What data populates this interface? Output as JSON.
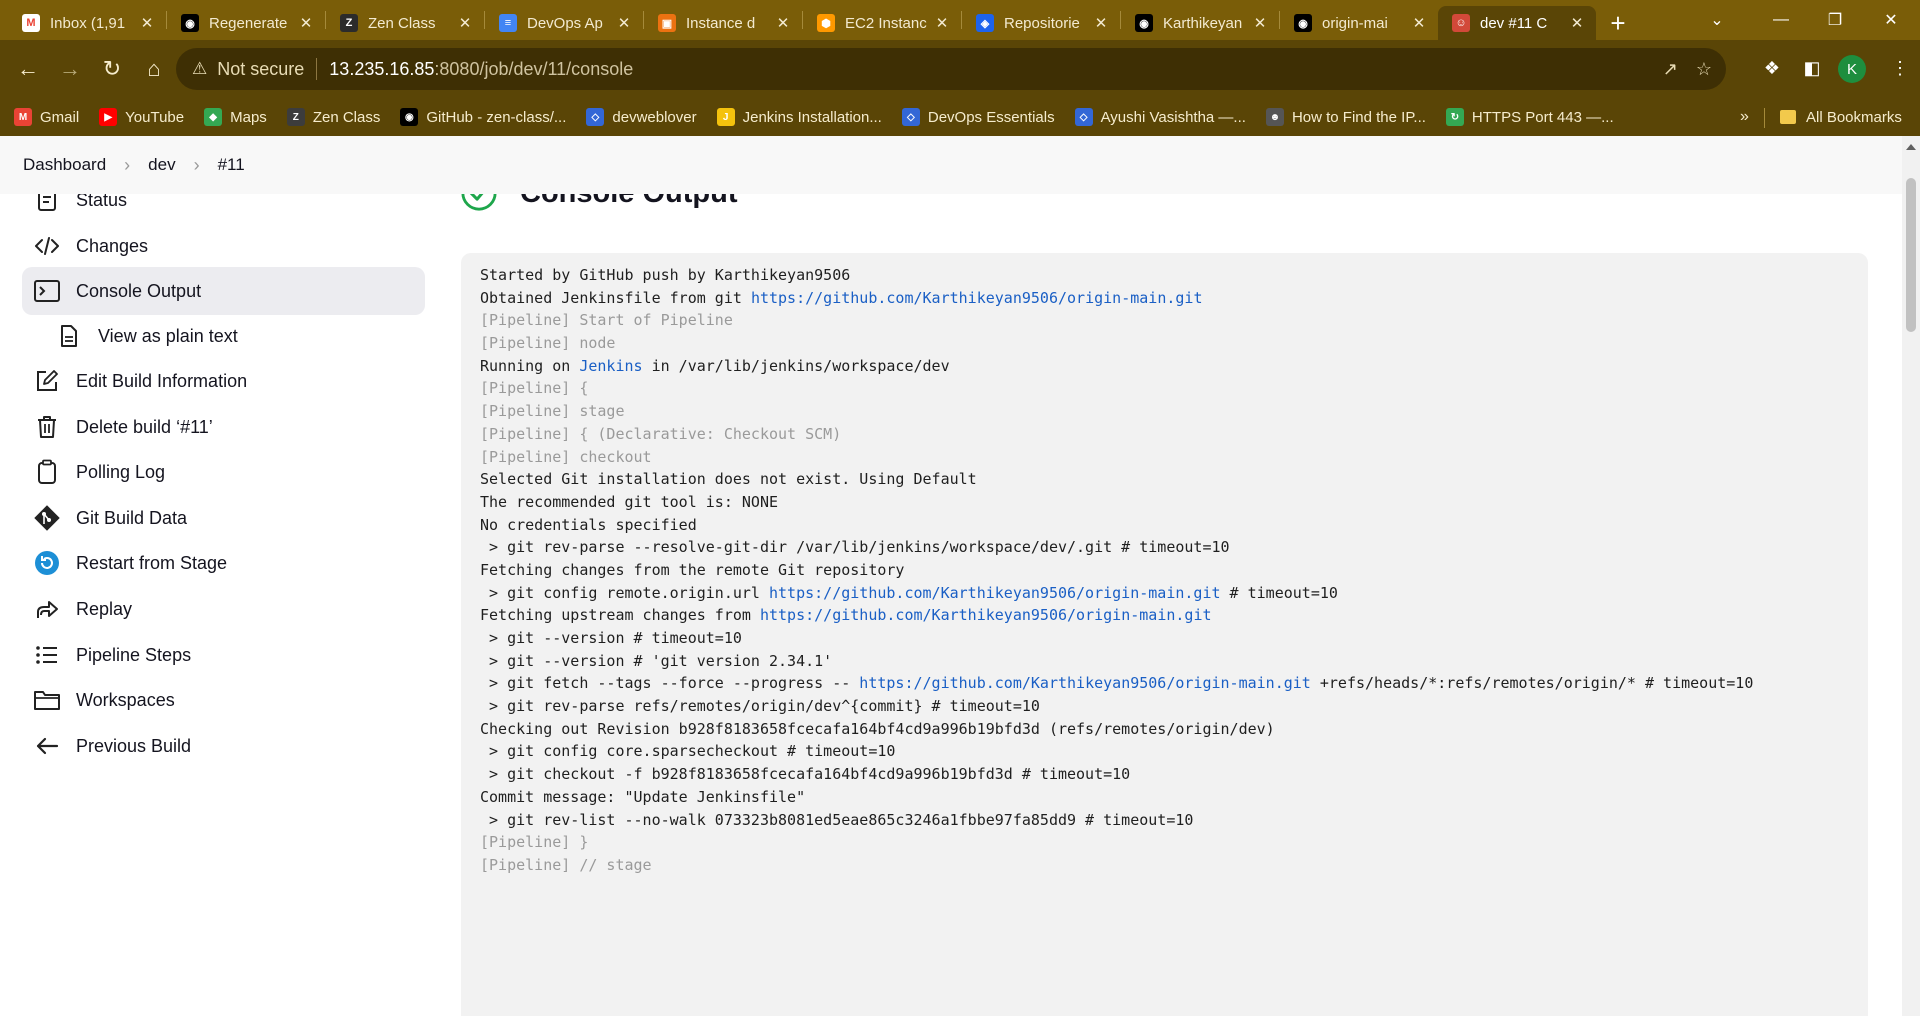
{
  "browser": {
    "tabs": [
      {
        "title": "Inbox (1,91",
        "icon": "gmail-icon",
        "color": "#ffffff"
      },
      {
        "title": "Regenerate",
        "icon": "github-icon",
        "color": "#000000"
      },
      {
        "title": "Zen Class",
        "icon": "zenclass-icon",
        "color": "#2b2b2b"
      },
      {
        "title": "DevOps Ap",
        "icon": "docs-icon",
        "color": "#4285f4"
      },
      {
        "title": "Instance d",
        "icon": "aws-icon",
        "color": "#ec7211"
      },
      {
        "title": "EC2 Instanc",
        "icon": "ec2-icon",
        "color": "#ff9900"
      },
      {
        "title": "Repositorie",
        "icon": "docker-icon",
        "color": "#1d63ed"
      },
      {
        "title": "Karthikeyan",
        "icon": "github-icon",
        "color": "#000000"
      },
      {
        "title": "origin-mai",
        "icon": "github-icon",
        "color": "#000000"
      },
      {
        "title": "dev #11 C",
        "icon": "jenkins-icon",
        "color": "#d24939",
        "active": true
      }
    ],
    "url": {
      "security_label": "Not secure",
      "host": "13.235.16.85",
      "path": ":8080/job/dev/11/console"
    },
    "avatar_letter": "K",
    "bookmarks": [
      {
        "label": "Gmail",
        "icon": "gmail-icon",
        "color": "#ea4335"
      },
      {
        "label": "YouTube",
        "icon": "youtube-icon",
        "color": "#ff0000"
      },
      {
        "label": "Maps",
        "icon": "maps-icon",
        "color": "#34a853"
      },
      {
        "label": "Zen Class",
        "icon": "zenclass-icon",
        "color": "#3c3c3c"
      },
      {
        "label": "GitHub - zen-class/...",
        "icon": "github-icon",
        "color": "#000000"
      },
      {
        "label": "devweblover",
        "icon": "devweblover-icon",
        "color": "#3367d6"
      },
      {
        "label": "Jenkins Installation...",
        "icon": "jenkins-install-icon",
        "color": "#f4c20d"
      },
      {
        "label": "DevOps Essentials",
        "icon": "devops-icon",
        "color": "#3367d6"
      },
      {
        "label": "Ayushi Vasishtha —...",
        "icon": "ayushi-icon",
        "color": "#3367d6"
      },
      {
        "label": "How to Find the IP...",
        "icon": "linux-icon",
        "color": "#555555"
      },
      {
        "label": "HTTPS Port 443 —...",
        "icon": "https-icon",
        "color": "#34a853"
      }
    ],
    "all_bookmarks": "All Bookmarks",
    "more_bookmarks": "»"
  },
  "breadcrumb": [
    "Dashboard",
    "dev",
    "#11"
  ],
  "sidebar": {
    "items": [
      {
        "label": "Status",
        "icon": "status-icon"
      },
      {
        "label": "Changes",
        "icon": "code-icon"
      },
      {
        "label": "Console Output",
        "icon": "terminal-icon",
        "active": true
      },
      {
        "label": "View as plain text",
        "icon": "document-icon",
        "sub": true
      },
      {
        "label": "Edit Build Information",
        "icon": "edit-icon"
      },
      {
        "label": "Delete build ‘#11’",
        "icon": "trash-icon"
      },
      {
        "label": "Polling Log",
        "icon": "clipboard-icon"
      },
      {
        "label": "Git Build Data",
        "icon": "git-icon"
      },
      {
        "label": "Restart from Stage",
        "icon": "restart-icon"
      },
      {
        "label": "Replay",
        "icon": "replay-icon"
      },
      {
        "label": "Pipeline Steps",
        "icon": "list-icon"
      },
      {
        "label": "Workspaces",
        "icon": "folder-icon"
      },
      {
        "label": "Previous Build",
        "icon": "arrow-left-icon"
      }
    ]
  },
  "main": {
    "title": "Console Output",
    "console_lines": [
      {
        "parts": [
          {
            "t": "Started by GitHub push by Karthikeyan9506"
          }
        ]
      },
      {
        "parts": [
          {
            "t": "Obtained Jenkinsfile from git "
          },
          {
            "t": "https://github.com/Karthikeyan9506/origin-main.git",
            "link": true
          }
        ]
      },
      {
        "gray": true,
        "parts": [
          {
            "t": "[Pipeline] Start of Pipeline"
          }
        ]
      },
      {
        "gray": true,
        "parts": [
          {
            "t": "[Pipeline] node"
          }
        ]
      },
      {
        "parts": [
          {
            "t": "Running on "
          },
          {
            "t": "Jenkins",
            "link": true
          },
          {
            "t": " in /var/lib/jenkins/workspace/dev"
          }
        ]
      },
      {
        "gray": true,
        "parts": [
          {
            "t": "[Pipeline] {"
          }
        ]
      },
      {
        "gray": true,
        "parts": [
          {
            "t": "[Pipeline] stage"
          }
        ]
      },
      {
        "gray": true,
        "parts": [
          {
            "t": "[Pipeline] { (Declarative: Checkout SCM)"
          }
        ]
      },
      {
        "gray": true,
        "parts": [
          {
            "t": "[Pipeline] checkout"
          }
        ]
      },
      {
        "parts": [
          {
            "t": "Selected Git installation does not exist. Using Default"
          }
        ]
      },
      {
        "parts": [
          {
            "t": "The recommended git tool is: NONE"
          }
        ]
      },
      {
        "parts": [
          {
            "t": "No credentials specified"
          }
        ]
      },
      {
        "parts": [
          {
            "t": " > git rev-parse --resolve-git-dir /var/lib/jenkins/workspace/dev/.git # timeout=10"
          }
        ]
      },
      {
        "parts": [
          {
            "t": "Fetching changes from the remote Git repository"
          }
        ]
      },
      {
        "parts": [
          {
            "t": " > git config remote.origin.url "
          },
          {
            "t": "https://github.com/Karthikeyan9506/origin-main.git",
            "link": true
          },
          {
            "t": " # timeout=10"
          }
        ]
      },
      {
        "parts": [
          {
            "t": "Fetching upstream changes from "
          },
          {
            "t": "https://github.com/Karthikeyan9506/origin-main.git",
            "link": true
          }
        ]
      },
      {
        "parts": [
          {
            "t": " > git --version # timeout=10"
          }
        ]
      },
      {
        "parts": [
          {
            "t": " > git --version # 'git version 2.34.1'"
          }
        ]
      },
      {
        "parts": [
          {
            "t": " > git fetch --tags --force --progress -- "
          },
          {
            "t": "https://github.com/Karthikeyan9506/origin-main.git",
            "link": true
          },
          {
            "t": " +refs/heads/*:refs/remotes/origin/* # timeout=10"
          }
        ]
      },
      {
        "parts": [
          {
            "t": " > git rev-parse refs/remotes/origin/dev^{commit} # timeout=10"
          }
        ]
      },
      {
        "parts": [
          {
            "t": "Checking out Revision b928f8183658fcecafa164bf4cd9a996b19bfd3d (refs/remotes/origin/dev)"
          }
        ]
      },
      {
        "parts": [
          {
            "t": " > git config core.sparsecheckout # timeout=10"
          }
        ]
      },
      {
        "parts": [
          {
            "t": " > git checkout -f b928f8183658fcecafa164bf4cd9a996b19bfd3d # timeout=10"
          }
        ]
      },
      {
        "parts": [
          {
            "t": "Commit message: \"Update Jenkinsfile\""
          }
        ]
      },
      {
        "parts": [
          {
            "t": " > git rev-list --no-walk 073323b8081ed5eae865c3246a1fbbe97fa85dd9 # timeout=10"
          }
        ]
      },
      {
        "gray": true,
        "parts": [
          {
            "t": "[Pipeline] }"
          }
        ]
      },
      {
        "gray": true,
        "parts": [
          {
            "t": "[Pipeline] // stage"
          }
        ]
      }
    ]
  },
  "colors": {
    "browser_frame": "#5a4506",
    "tab_strip": "#7a5d08",
    "link": "#1a5fc5",
    "success": "#1ea64b"
  }
}
